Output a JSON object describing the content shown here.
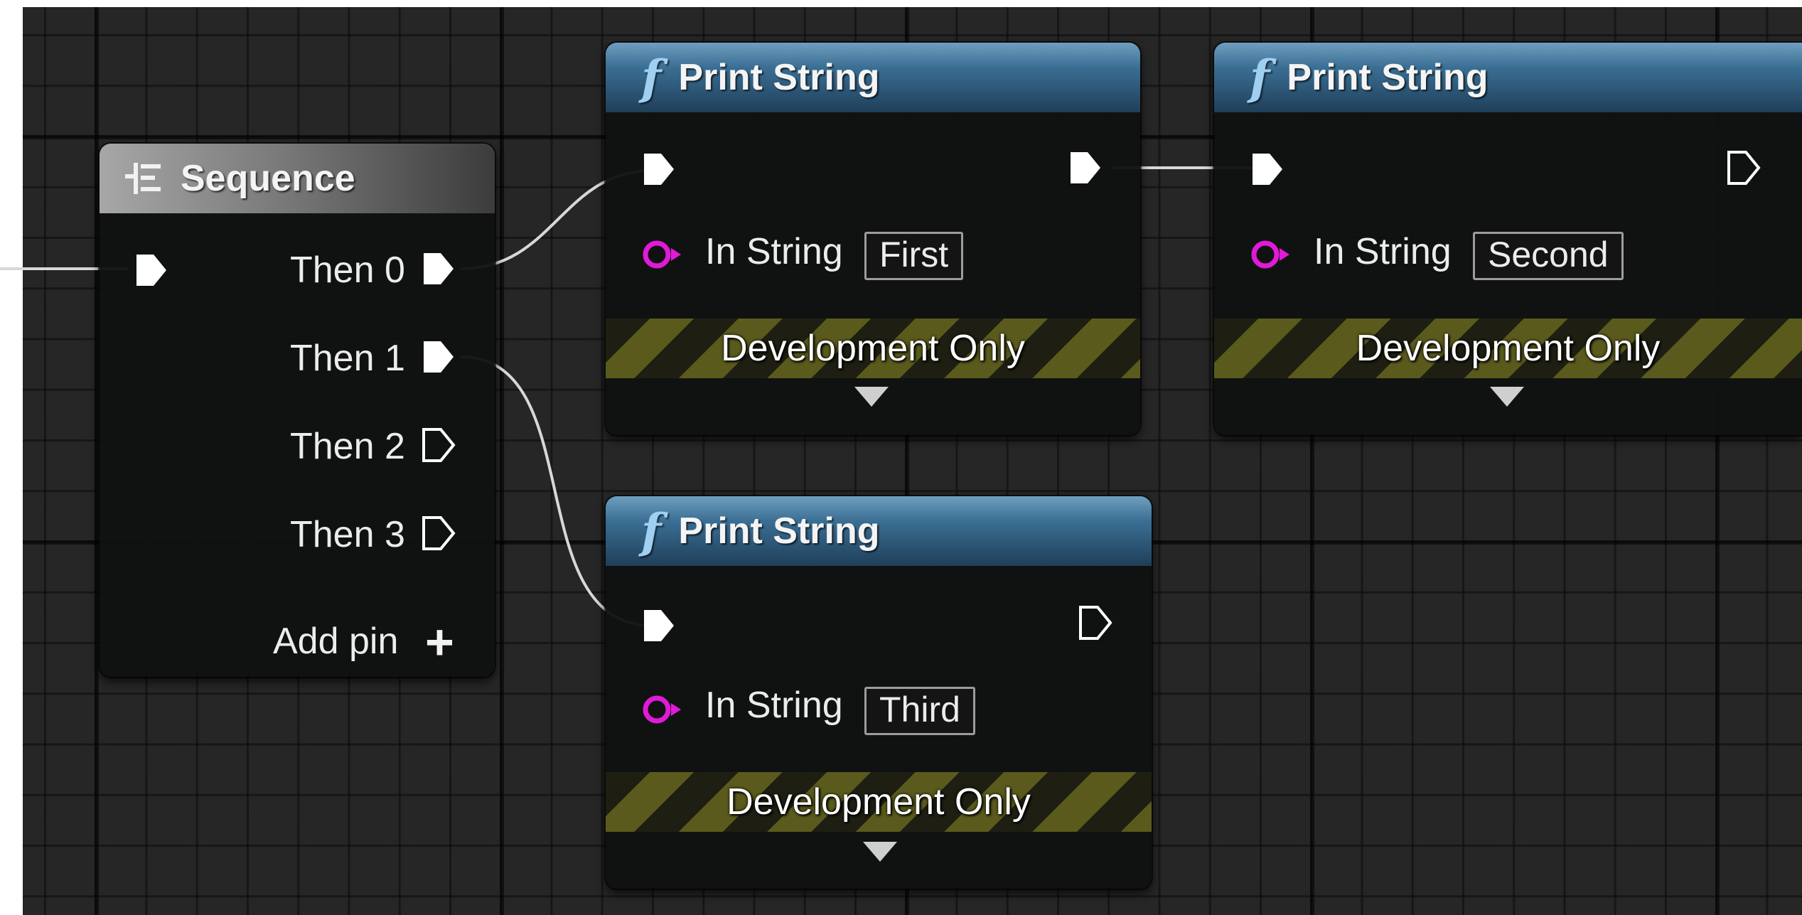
{
  "sequence_node": {
    "title": "Sequence",
    "outputs": [
      "Then 0",
      "Then 1",
      "Then 2",
      "Then 3"
    ],
    "add_pin_label": "Add pin"
  },
  "print_nodes": [
    {
      "title": "Print String",
      "pin_label": "In String",
      "value": "First",
      "dev_label": "Development Only"
    },
    {
      "title": "Print String",
      "pin_label": "In String",
      "value": "Second",
      "dev_label": "Development Only"
    },
    {
      "title": "Print String",
      "pin_label": "In String",
      "value": "Third",
      "dev_label": "Development Only"
    }
  ],
  "icons": {
    "function": "function-icon",
    "sequence": "sequence-icon",
    "exec_pin": "exec-pin-icon",
    "string_pin": "string-pin-icon",
    "expand": "expand-arrow-icon",
    "add": "plus-icon"
  },
  "colors": {
    "canvas": "#262626",
    "function_header": "#3b6f94",
    "string_pin": "#e11ad7",
    "dev_stripe": "#5a5a1d",
    "wire": "#d8d8d8"
  }
}
